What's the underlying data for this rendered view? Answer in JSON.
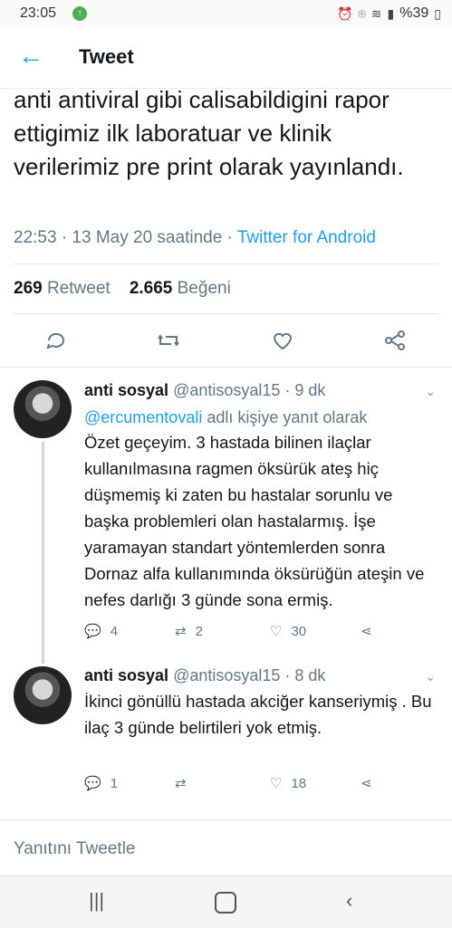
{
  "status_bar": {
    "time": "23:05",
    "battery": "%39"
  },
  "header": {
    "title": "Tweet"
  },
  "tweet": {
    "text": "anti  antiviral gibi calisabildigini rapor ettigimiz ilk laboratuar ve klinik verilerimiz pre print olarak yayınlandı.",
    "timestamp": "22:53 · 13 May 20 saatinde · ",
    "source": "Twitter for Android",
    "retweet_count": "269",
    "retweet_label": " Retweet",
    "like_count": "2.665",
    "like_label": " Beğeni"
  },
  "replies": [
    {
      "name": "anti sosyal",
      "handle": "@antisosyal15 · 9 dk",
      "reply_to_mention": "@ercumentovali",
      "reply_to_suffix": " adlı kişiye yanıt olarak",
      "text": "Özet geçeyim. 3 hastada bilinen ilaçlar kullanılmasına ragmen öksürük ateş hiç düşmemiş ki zaten bu hastalar sorunlu ve başka problemleri olan hastalarmış. İşe yaramayan standart yöntemlerden sonra Dornaz alfa kullanımında öksürüğün ateşin ve nefes darlığı 3 günde sona ermiş.",
      "reply_count": "4",
      "retweet_count": "2",
      "like_count": "30"
    },
    {
      "name": "anti sosyal",
      "handle": "@antisosyal15 · 8 dk",
      "text": "İkinci gönüllü hastada akciğer kanseriymiş . Bu ilaç 3 günde belirtileri yok etmiş.",
      "reply_count": "1",
      "retweet_count": "",
      "like_count": "18"
    }
  ],
  "compose": {
    "placeholder": "Yanıtını Tweetle"
  },
  "colors": {
    "accent": "#1da1f2",
    "secondary_text": "#657786",
    "divider": "#e1e8ed"
  }
}
